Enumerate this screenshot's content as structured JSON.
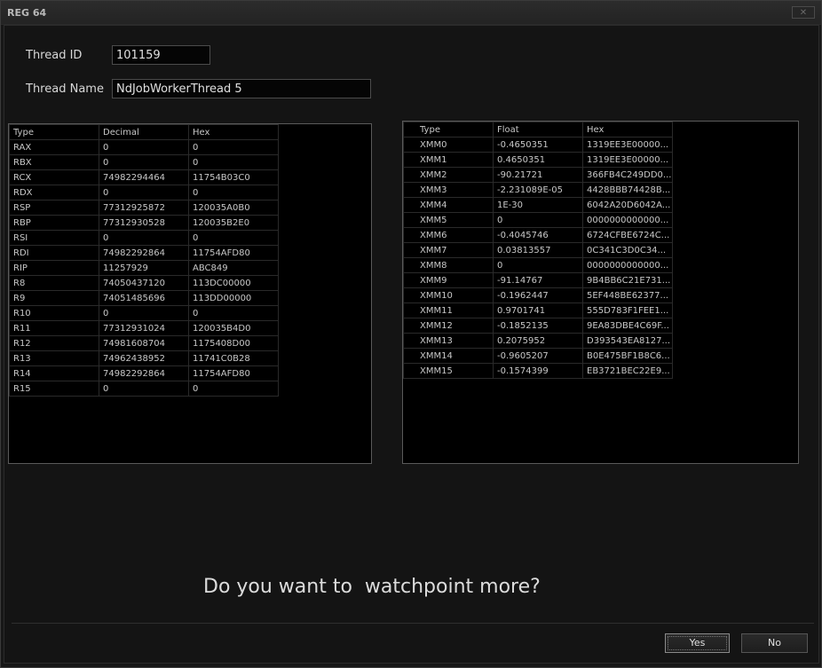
{
  "window": {
    "title": "REG 64",
    "close_glyph": "✕"
  },
  "thread": {
    "id_label": "Thread ID",
    "id_value": "101159",
    "name_label": "Thread Name",
    "name_value": "NdJobWorkerThread 5"
  },
  "gp_registers": {
    "columns": [
      "Type",
      "Decimal",
      "Hex"
    ],
    "rows": [
      [
        "RAX",
        "0",
        "0"
      ],
      [
        "RBX",
        "0",
        "0"
      ],
      [
        "RCX",
        "74982294464",
        "11754B03C0"
      ],
      [
        "RDX",
        "0",
        "0"
      ],
      [
        "RSP",
        "77312925872",
        "120035A0B0"
      ],
      [
        "RBP",
        "77312930528",
        "120035B2E0"
      ],
      [
        "RSI",
        "0",
        "0"
      ],
      [
        "RDI",
        "74982292864",
        "11754AFD80"
      ],
      [
        "RIP",
        "11257929",
        "ABC849"
      ],
      [
        "R8",
        "74050437120",
        "113DC00000"
      ],
      [
        "R9",
        "74051485696",
        "113DD00000"
      ],
      [
        "R10",
        "0",
        "0"
      ],
      [
        "R11",
        "77312931024",
        "120035B4D0"
      ],
      [
        "R12",
        "74981608704",
        "1175408D00"
      ],
      [
        "R13",
        "74962438952",
        "11741C0B28"
      ],
      [
        "R14",
        "74982292864",
        "11754AFD80"
      ],
      [
        "R15",
        "0",
        "0"
      ]
    ]
  },
  "xmm_registers": {
    "columns": [
      "Type",
      "Float",
      "Hex"
    ],
    "rows": [
      [
        "XMM0",
        "-0.4650351",
        "1319EE3E00000..."
      ],
      [
        "XMM1",
        "0.4650351",
        "1319EE3E00000..."
      ],
      [
        "XMM2",
        "-90.21721",
        "366FB4C249DD0..."
      ],
      [
        "XMM3",
        "-2.231089E-05",
        "4428BBB74428B..."
      ],
      [
        "XMM4",
        "1E-30",
        "6042A20D6042A..."
      ],
      [
        "XMM5",
        "0",
        "0000000000000..."
      ],
      [
        "XMM6",
        "-0.4045746",
        "6724CFBE6724C..."
      ],
      [
        "XMM7",
        "0.03813557",
        "0C341C3D0C34..."
      ],
      [
        "XMM8",
        "0",
        "0000000000000..."
      ],
      [
        "XMM9",
        "-91.14767",
        "9B4BB6C21E731..."
      ],
      [
        "XMM10",
        "-0.1962447",
        "5EF448BE62377..."
      ],
      [
        "XMM11",
        "0.9701741",
        "555D783F1FEE1..."
      ],
      [
        "XMM12",
        "-0.1852135",
        "9EA83DBE4C69F..."
      ],
      [
        "XMM13",
        "0.2075952",
        "D393543EA8127..."
      ],
      [
        "XMM14",
        "-0.9605207",
        "B0E475BF1B8C6..."
      ],
      [
        "XMM15",
        "-0.1574399",
        "EB3721BEC22E9..."
      ]
    ]
  },
  "prompt": {
    "text": "Do you want to  watchpoint more?"
  },
  "buttons": {
    "yes_label": "Yes",
    "no_label": "No"
  }
}
